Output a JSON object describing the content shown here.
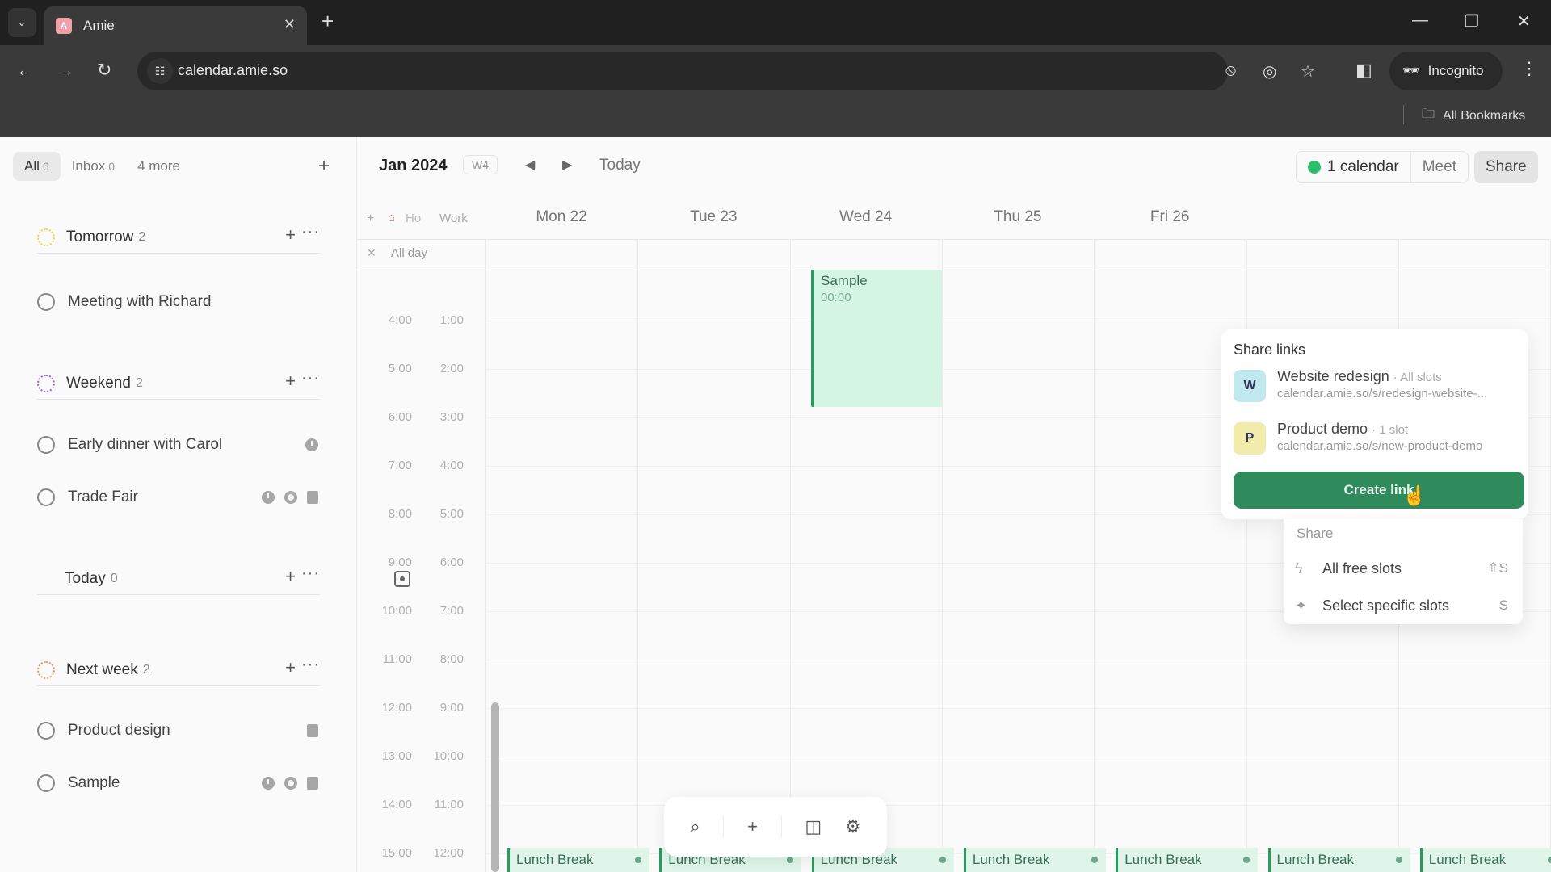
{
  "browser": {
    "tab_title": "Amie",
    "tab_favicon_letter": "A",
    "url": "calendar.amie.so",
    "incognito_label": "Incognito",
    "bookmarks_label": "All Bookmarks"
  },
  "sidebar": {
    "tabs": [
      {
        "label": "All",
        "count": "6",
        "active": true
      },
      {
        "label": "Inbox",
        "count": "0",
        "active": false
      },
      {
        "label": "4 more",
        "count": "",
        "active": false
      }
    ],
    "groups": [
      {
        "title": "Tomorrow",
        "count": "2",
        "icon_color": "#e8d84a",
        "tasks": [
          {
            "label": "Meeting with Richard",
            "icons": []
          }
        ]
      },
      {
        "title": "Weekend",
        "count": "2",
        "icon_color": "#9a5fd6",
        "tasks": [
          {
            "label": "Early dinner with Carol",
            "icons": [
              "clock-icon"
            ]
          },
          {
            "label": "Trade Fair",
            "icons": [
              "clock-icon",
              "recurring-icon",
              "note-icon"
            ]
          }
        ]
      },
      {
        "title": "Today",
        "count": "0",
        "icon_color": "#666666",
        "tasks": []
      },
      {
        "title": "Next week",
        "count": "2",
        "icon_color": "#e8965a",
        "tasks": [
          {
            "label": "Product design",
            "icons": [
              "note-icon"
            ]
          },
          {
            "label": "Sample",
            "icons": [
              "clock-icon",
              "recurring-icon",
              "note-icon"
            ]
          }
        ]
      }
    ]
  },
  "calendar": {
    "month_label": "Jan 2024",
    "week_label": "W4",
    "today_label": "Today",
    "calendars_label": "1 calendar",
    "calendar_dot_color": "#2bbf6b",
    "meet_label": "Meet",
    "share_label": "Share",
    "timezones": [
      "Ho",
      "Work"
    ],
    "allday_label": "All day",
    "days": [
      "Mon 22",
      "Tue 23",
      "Wed 24",
      "Thu 25",
      "Fri 26"
    ],
    "time_primary": [
      "4:00",
      "5:00",
      "6:00",
      "7:00",
      "8:00",
      "9:00",
      "10:00",
      "11:00",
      "12:00",
      "13:00",
      "14:00",
      "15:00"
    ],
    "time_secondary": [
      "1:00",
      "2:00",
      "3:00",
      "4:00",
      "5:00",
      "6:00",
      "7:00",
      "8:00",
      "9:00",
      "10:00",
      "11:00",
      "12:00"
    ],
    "event": {
      "title": "Sample",
      "time": "00:00",
      "day": "Wed 24"
    },
    "lunch_label": "Lunch Break",
    "lunch_count": 7
  },
  "share_popover": {
    "title": "Share links",
    "links": [
      {
        "avatar": "W",
        "avatar_color": "#bfe9ef",
        "name": "Website redesign",
        "meta": "· All slots",
        "url": "calendar.amie.so/s/redesign-website-..."
      },
      {
        "avatar": "P",
        "avatar_color": "#f1ecaa",
        "name": "Product demo",
        "meta": "· 1 slot",
        "url": "calendar.amie.so/s/new-product-demo"
      }
    ],
    "create_label": "Create link",
    "dropdown": {
      "heading": "Share",
      "items": [
        {
          "label": "All free slots",
          "shortcut": "⇧S",
          "icon": "bolt-icon"
        },
        {
          "label": "Select specific slots",
          "shortcut": "S",
          "icon": "sparkle-cursor-icon"
        }
      ]
    }
  }
}
